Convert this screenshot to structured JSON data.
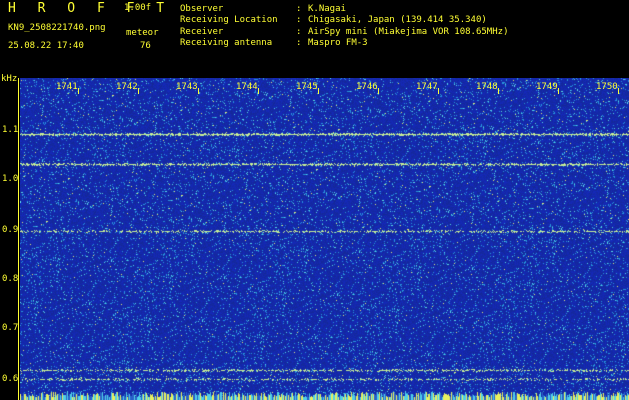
{
  "header": {
    "title": "H R O F F T",
    "version": "1.00f",
    "filename": "KN9_2508221740.png",
    "datetime": "25.08.22 17:40",
    "meteor_label": "meteor",
    "meteor_count": "76"
  },
  "info": [
    {
      "label": "Observer",
      "value": "K.Nagai"
    },
    {
      "label": "Receiving Location",
      "value": "Chigasaki, Japan (139.414 35.340)"
    },
    {
      "label": "Receiver",
      "value": "AirSpy mini (Miakejima VOR 108.65MHz)"
    },
    {
      "label": "Receiving antenna",
      "value": "Maspro FM-3"
    }
  ],
  "axis": {
    "y_unit": "kHz",
    "y_labels": [
      "1.1",
      "1.0",
      "0.9",
      "0.8",
      "0.7",
      "0.6"
    ],
    "x_labels": [
      "1741",
      "1742",
      "1743",
      "1744",
      "1745",
      "1746",
      "1747",
      "1748",
      "1749",
      "1750"
    ]
  },
  "colors": {
    "text": "#ffff33",
    "background": "#000000",
    "noise_base": "#1a2fa8"
  }
}
